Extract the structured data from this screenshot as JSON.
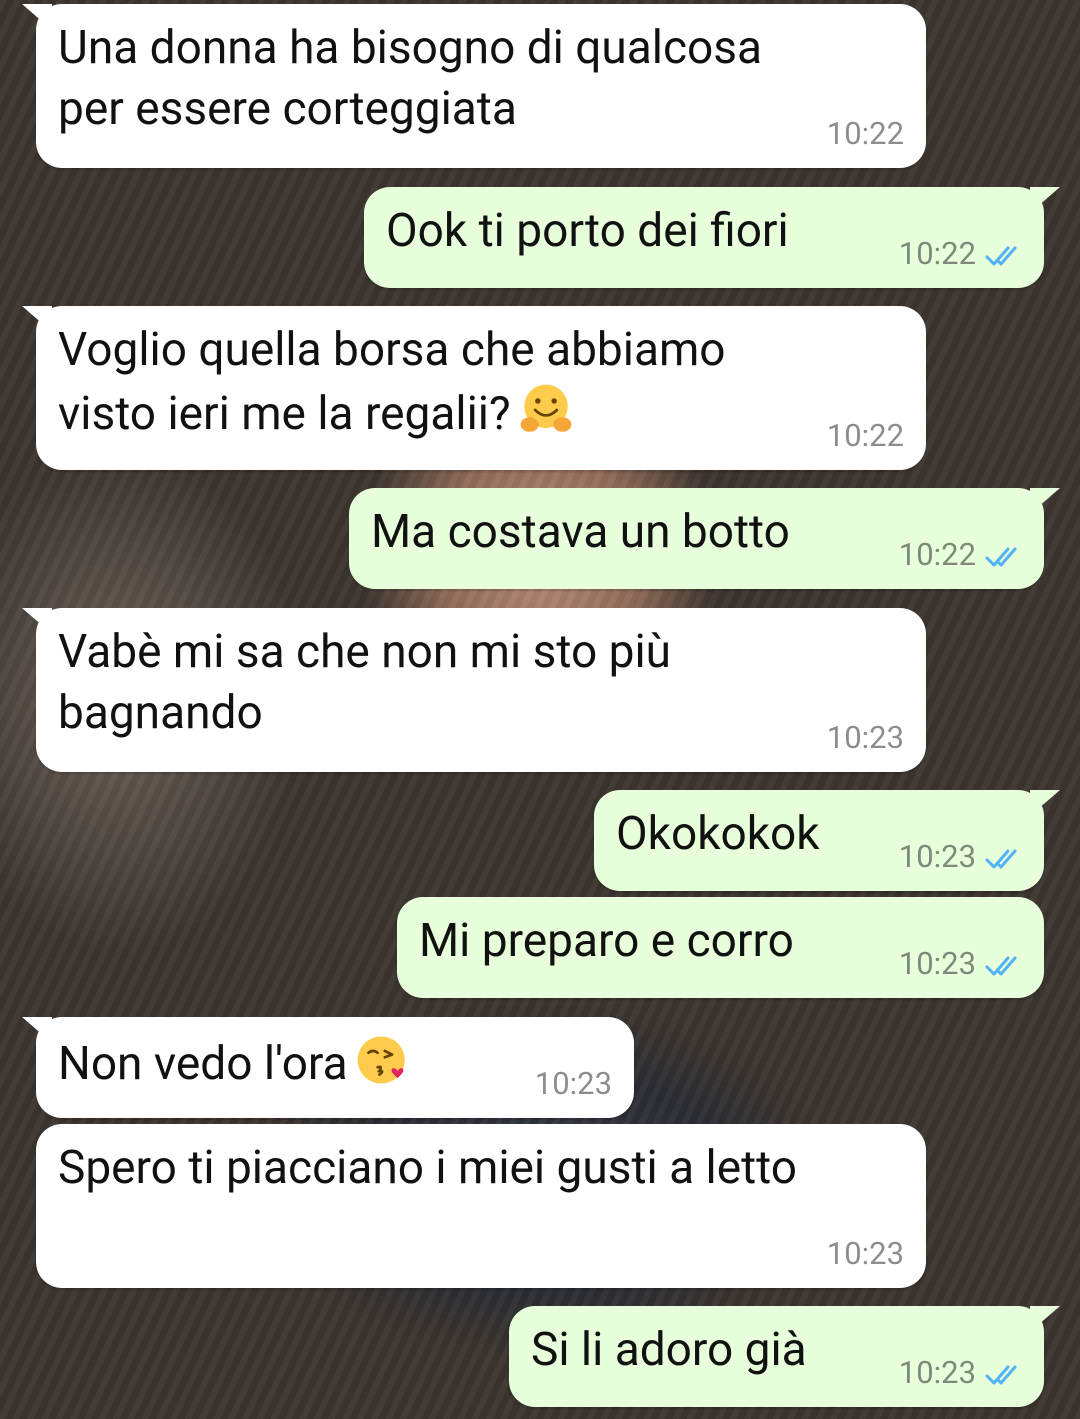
{
  "messages": [
    {
      "text": "Una donna ha bisogno di qualcosa\nper essere corteggiata",
      "time": "10:22"
    },
    {
      "text": "Ook ti porto dei fiori",
      "time": "10:22",
      "status_icon": "double-check-read-icon"
    },
    {
      "text": "Voglio quella borsa che abbiamo\nvisto ieri me la regalii?",
      "emoji": "hugging-face-emoji",
      "time": "10:22"
    },
    {
      "text": "Ma costava un botto",
      "time": "10:22",
      "status_icon": "double-check-read-icon"
    },
    {
      "text": "Vabè mi sa che non mi sto più\nbagnando",
      "time": "10:23"
    },
    {
      "text": "Okokokok",
      "time": "10:23",
      "status_icon": "double-check-read-icon"
    },
    {
      "text": "Mi preparo e corro",
      "time": "10:23",
      "status_icon": "double-check-read-icon"
    },
    {
      "text": "Non vedo l'ora",
      "emoji": "face-blowing-kiss-emoji",
      "time": "10:23"
    },
    {
      "text": "Spero ti piacciano i miei gusti a letto",
      "time": "10:23"
    },
    {
      "text": "Si li adoro già",
      "time": "10:23",
      "status_icon": "double-check-read-icon"
    }
  ],
  "colors": {
    "incoming_bubble": "#ffffff",
    "outgoing_bubble": "#e7ffdb",
    "read_ticks": "#4fb3f6",
    "timestamp": "#8d8d8d"
  }
}
